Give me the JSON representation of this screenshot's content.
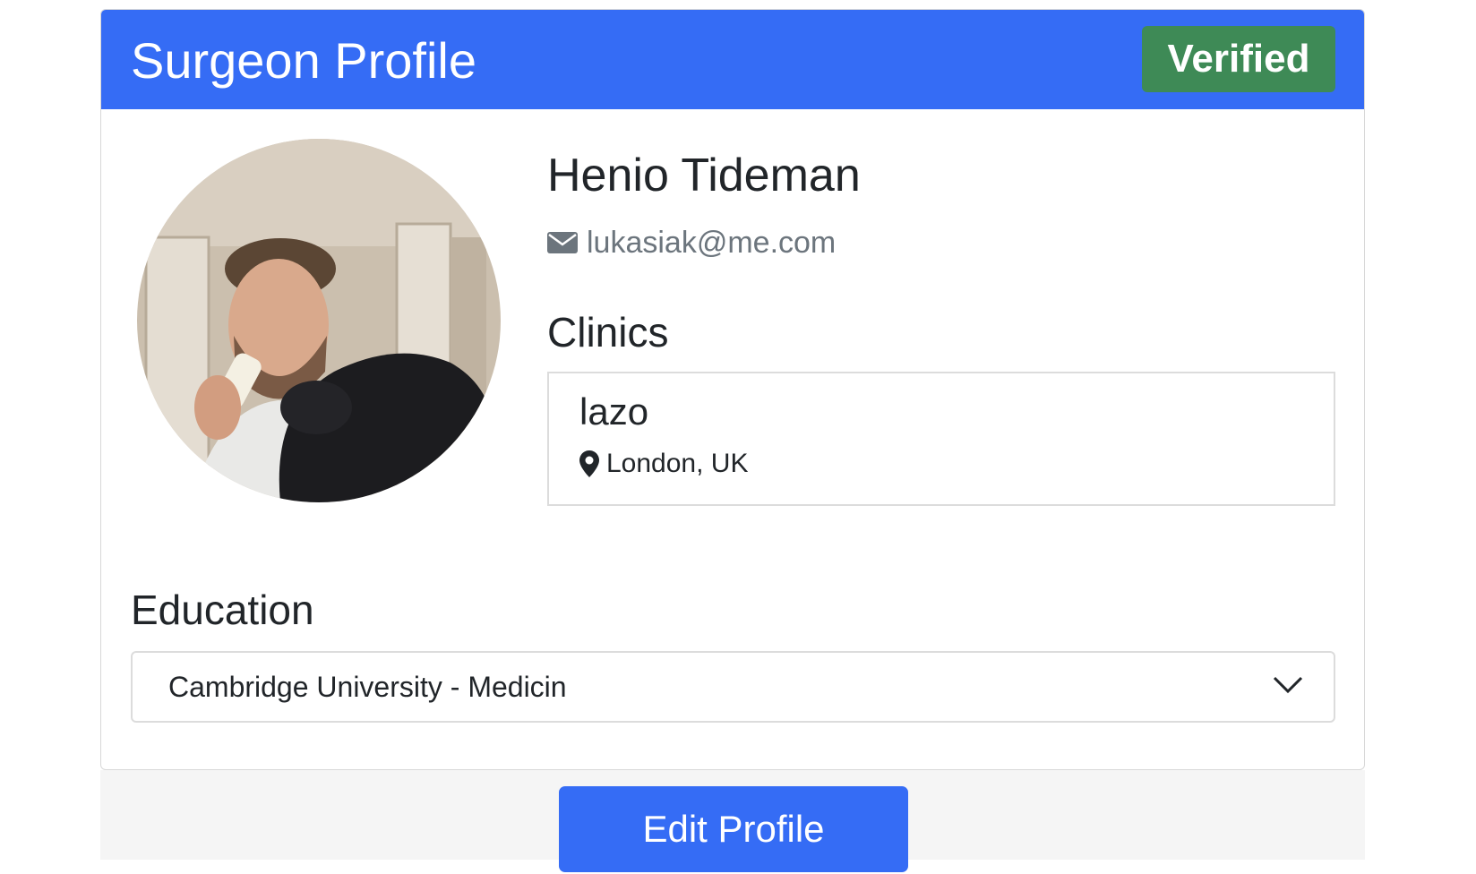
{
  "header": {
    "title": "Surgeon Profile",
    "badge": "Verified"
  },
  "profile": {
    "name": "Henio Tideman",
    "email": "lukasiak@me.com",
    "email_icon": "envelope-icon",
    "avatar_alt": "profile-photo"
  },
  "clinics": {
    "heading": "Clinics",
    "items": [
      {
        "name": "lazo",
        "location": "London, UK",
        "location_icon": "map-pin-icon"
      }
    ]
  },
  "education": {
    "heading": "Education",
    "items": [
      {
        "label": "Cambridge University - Medicin",
        "icon": "chevron-down-icon"
      }
    ]
  },
  "footer": {
    "edit_label": "Edit Profile"
  },
  "colors": {
    "primary": "#356cf5",
    "verified": "#3e8a56",
    "muted": "#6c757d"
  }
}
